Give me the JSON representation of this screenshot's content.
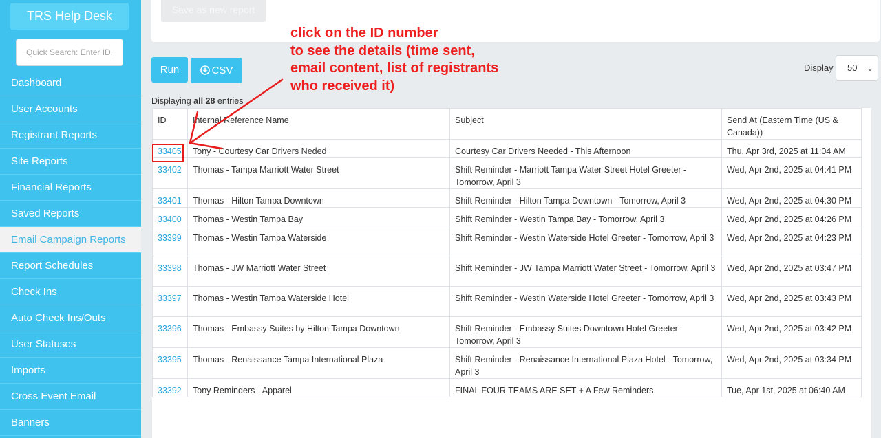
{
  "sidebar": {
    "brand": "TRS Help Desk",
    "search_placeholder": "Quick Search: Enter ID, f",
    "items": [
      {
        "label": "Dashboard"
      },
      {
        "label": "User Accounts"
      },
      {
        "label": "Registrant Reports"
      },
      {
        "label": "Site Reports"
      },
      {
        "label": "Financial Reports"
      },
      {
        "label": "Saved Reports"
      },
      {
        "label": "Email Campaign Reports"
      },
      {
        "label": "Report Schedules"
      },
      {
        "label": "Check Ins"
      },
      {
        "label": "Auto Check Ins/Outs"
      },
      {
        "label": "User Statuses"
      },
      {
        "label": "Imports"
      },
      {
        "label": "Cross Event Email"
      },
      {
        "label": "Banners"
      }
    ],
    "active_item": "Email Campaign Reports"
  },
  "toolbar": {
    "save_label": "Save as new report",
    "run_label": "Run",
    "csv_label": "CSV",
    "display_label": "Display",
    "display_value": "50"
  },
  "entries": {
    "prefix": "Displaying",
    "bold": "all 28",
    "suffix": "entries"
  },
  "table": {
    "headers": {
      "id": "ID",
      "name": "Internal Reference Name",
      "subject": "Subject",
      "send_at": "Send At (Eastern Time (US & Canada))"
    },
    "rows": [
      {
        "id": "33405",
        "name": "Tony - Courtesy Car Drivers Neded",
        "subject": "Courtesy Car Drivers Needed - This Afternoon",
        "send_at": "Thu, Apr 3rd, 2025 at 11:04 AM"
      },
      {
        "id": "33402",
        "name": "Thomas - Tampa Marriott Water Street",
        "subject": "Shift Reminder - Marriott Tampa Water Street Hotel Greeter - Tomorrow, April 3",
        "send_at": "Wed, Apr 2nd, 2025 at 04:41 PM"
      },
      {
        "id": "33401",
        "name": "Thomas - Hilton Tampa Downtown",
        "subject": "Shift Reminder - Hilton Tampa Downtown - Tomorrow, April 3",
        "send_at": "Wed, Apr 2nd, 2025 at 04:30 PM"
      },
      {
        "id": "33400",
        "name": "Thomas - Westin Tampa Bay",
        "subject": "Shift Reminder - Westin Tampa Bay - Tomorrow, April 3",
        "send_at": "Wed, Apr 2nd, 2025 at 04:26 PM"
      },
      {
        "id": "33399",
        "name": "Thomas - Westin Tampa Waterside",
        "subject": "Shift Reminder - Westin Waterside Hotel Greeter - Tomorrow, April 3",
        "send_at": "Wed, Apr 2nd, 2025 at 04:23 PM"
      },
      {
        "id": "33398",
        "name": "Thomas - JW Marriott Water Street",
        "subject": "Shift Reminder - JW Tampa Marriott Water Street - Tomorrow, April 3",
        "send_at": "Wed, Apr 2nd, 2025 at 03:47 PM"
      },
      {
        "id": "33397",
        "name": "Thomas - Westin Tampa Waterside Hotel",
        "subject": "Shift Reminder - Westin Waterside Hotel Greeter - Tomorrow, April 3",
        "send_at": "Wed, Apr 2nd, 2025 at 03:43 PM"
      },
      {
        "id": "33396",
        "name": "Thomas - Embassy Suites by Hilton Tampa Downtown",
        "subject": "Shift Reminder - Embassy Suites Downtown Hotel Greeter - Tomorrow, April 3",
        "send_at": "Wed, Apr 2nd, 2025 at 03:42 PM"
      },
      {
        "id": "33395",
        "name": "Thomas - Renaissance Tampa International Plaza",
        "subject": "Shift Reminder - Renaissance International Plaza Hotel - Tomorrow, April 3",
        "send_at": "Wed, Apr 2nd, 2025 at 03:34 PM"
      },
      {
        "id": "33392",
        "name": "Tony Reminders - Apparel",
        "subject": "FINAL FOUR TEAMS ARE SET + A Few Reminders",
        "send_at": "Tue, Apr 1st, 2025 at 06:40 AM"
      }
    ]
  },
  "annotation": {
    "lines": [
      "click on the ID number",
      "to see the details (time sent,",
      "email content, list of registrants",
      "who received it)"
    ],
    "color": "#ee1f1f"
  },
  "colors": {
    "sidebar": "#3fc3ee",
    "accent": "#3cc2ee",
    "link": "#2aa7de"
  },
  "icons": {
    "csv": "download-circle-icon",
    "select": "chevron-down-icon"
  }
}
